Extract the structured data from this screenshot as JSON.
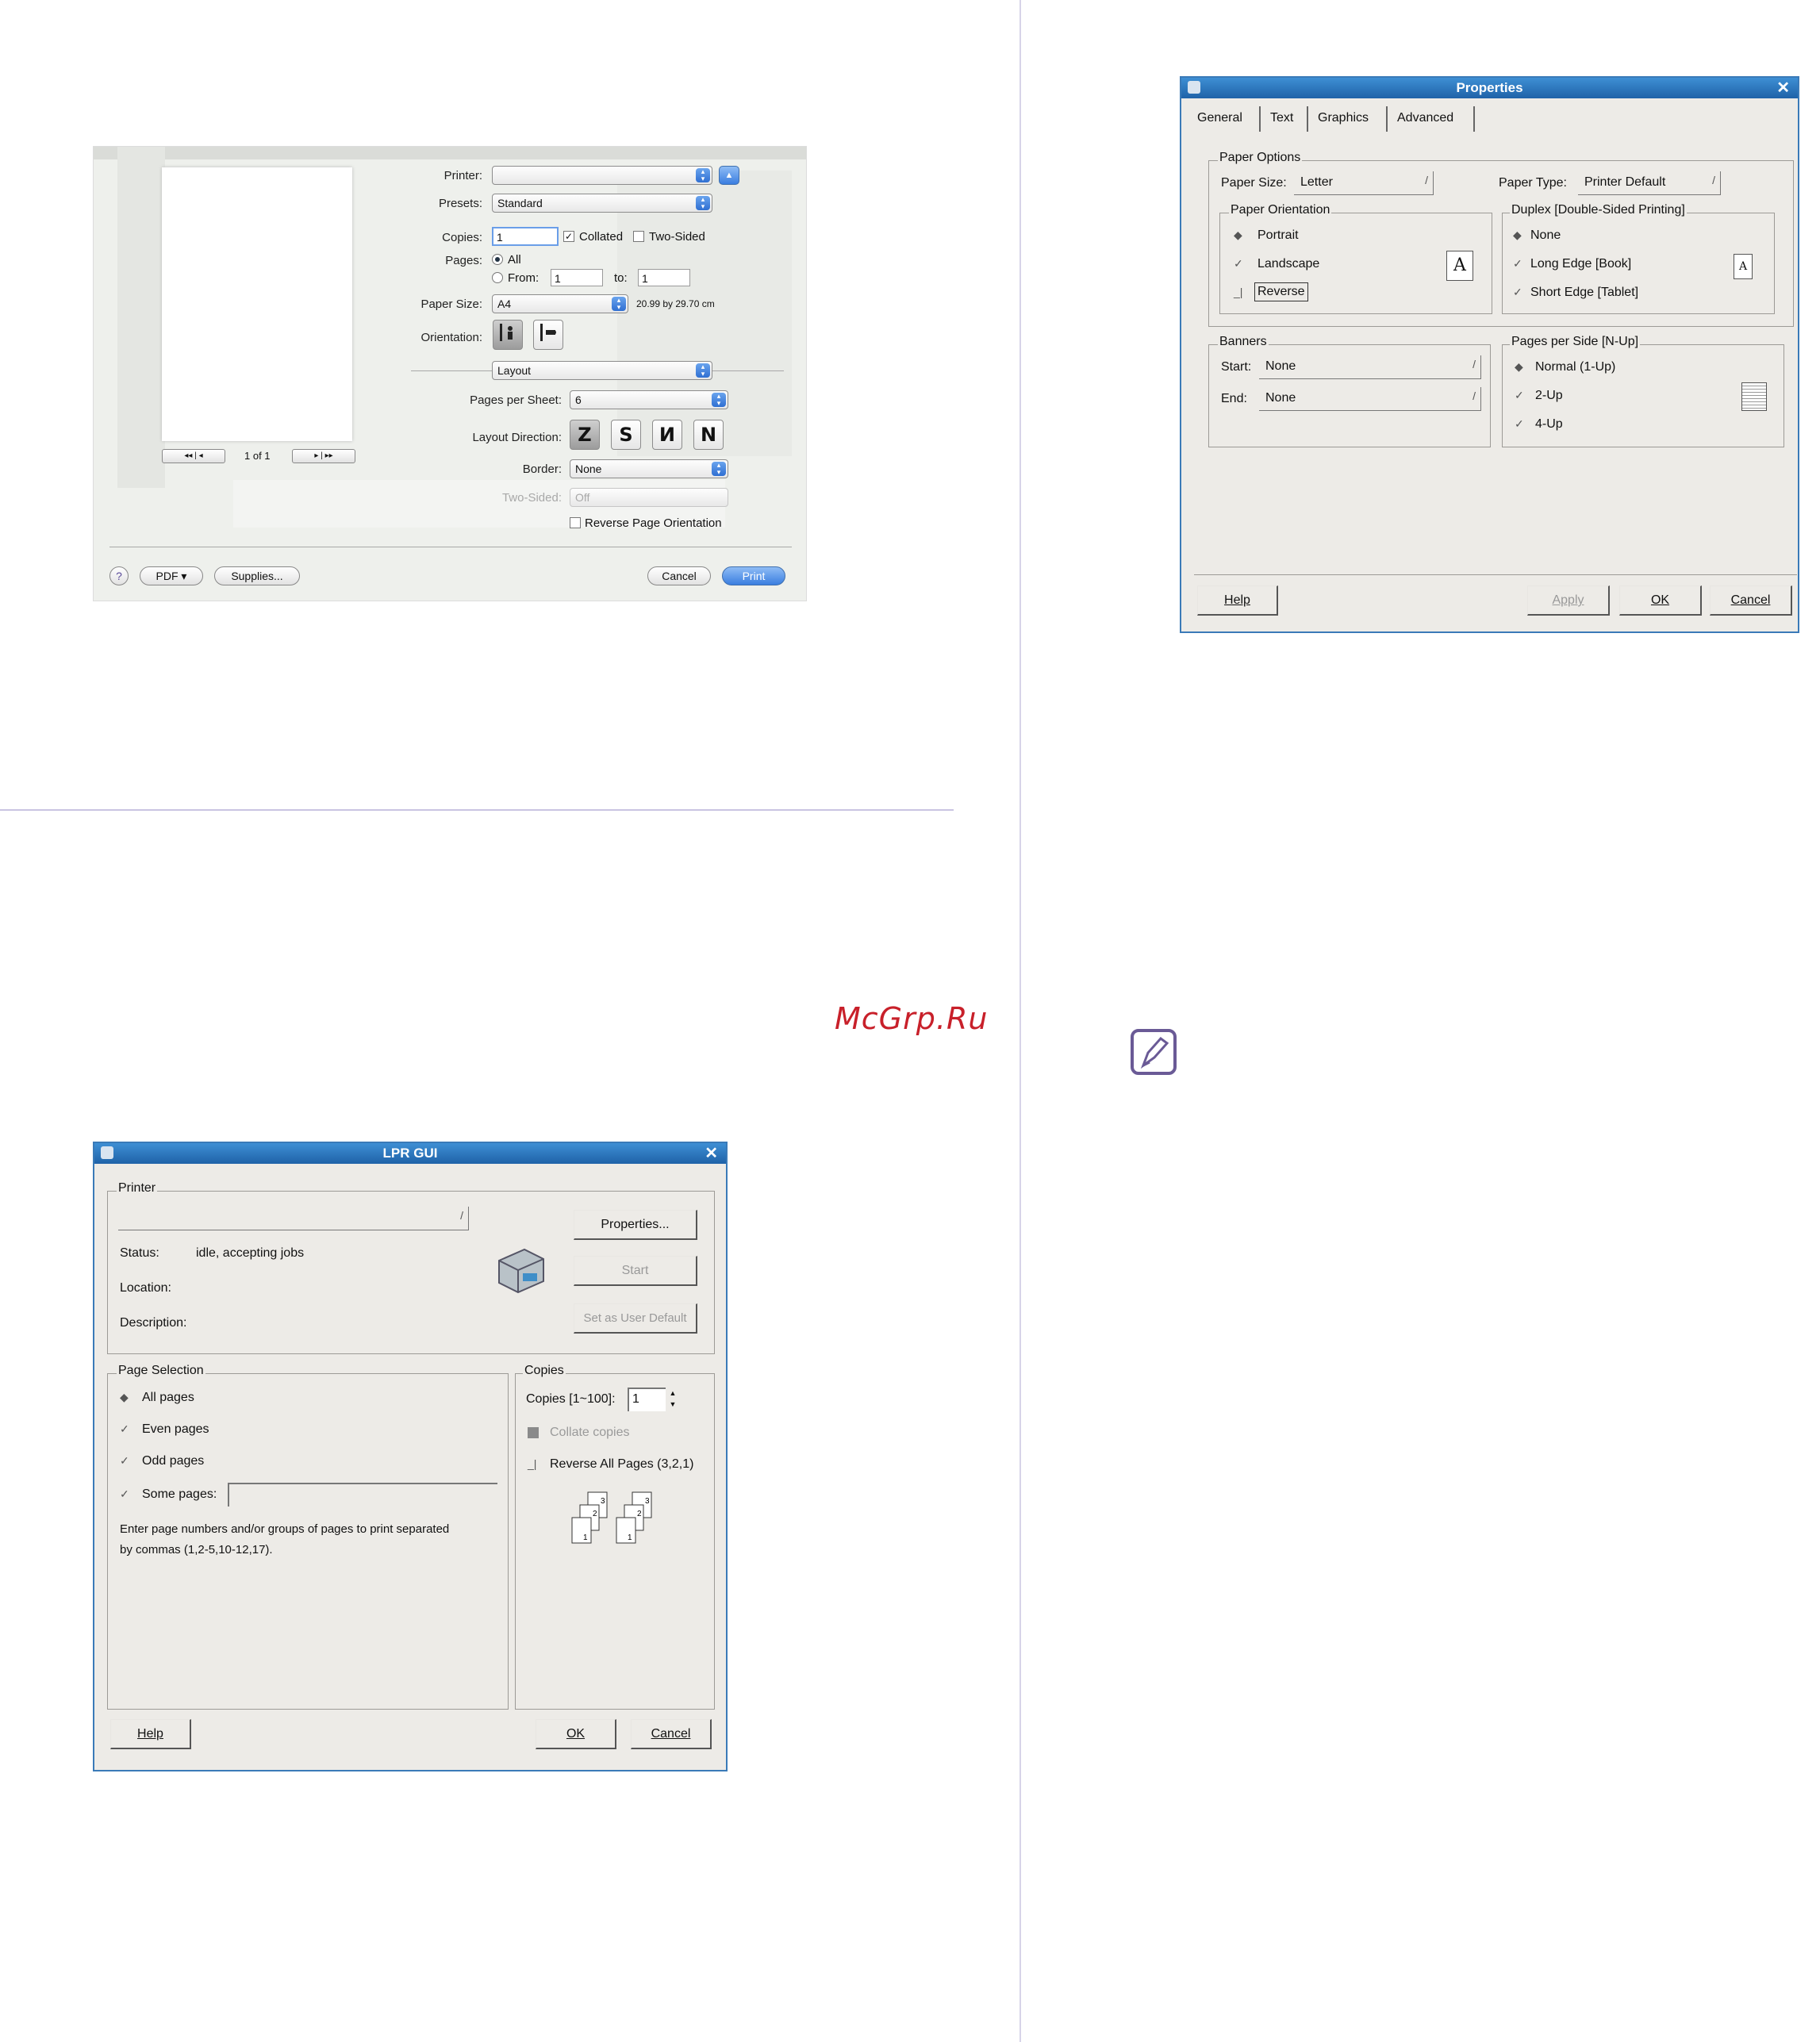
{
  "watermark": "McGrp.Ru",
  "mac_dialog": {
    "printer_label": "Printer:",
    "presets_label": "Presets:",
    "presets_value": "Standard",
    "copies_label": "Copies:",
    "copies_value": "1",
    "collated_label": "Collated",
    "two_sided_label": "Two-Sided",
    "pages_label": "Pages:",
    "pages_all": "All",
    "pages_from": "From:",
    "from_value": "1",
    "to_label": "to:",
    "to_value": "1",
    "paper_size_label": "Paper Size:",
    "paper_size_value": "A4",
    "paper_size_dims": "20.99 by 29.70 cm",
    "orientation_label": "Orientation:",
    "section_value": "Layout",
    "pages_per_sheet_label": "Pages per Sheet:",
    "pages_per_sheet_value": "6",
    "layout_direction_label": "Layout Direction:",
    "layout_direction_icons": [
      "Z",
      "S",
      "N",
      "N"
    ],
    "border_label": "Border:",
    "border_value": "None",
    "two_sided_field_label": "Two-Sided:",
    "two_sided_value": "Off",
    "reverse_orientation_label": "Reverse Page Orientation",
    "page_counter": "1 of 1",
    "help_symbol": "?",
    "pdf_button": "PDF ▾",
    "supplies_button": "Supplies...",
    "cancel_button": "Cancel",
    "print_button": "Print"
  },
  "properties_dialog": {
    "title": "Properties",
    "close": "✕",
    "tabs": [
      "General",
      "Text",
      "Graphics",
      "Advanced"
    ],
    "paper_options_title": "Paper Options",
    "paper_size_label": "Paper Size:",
    "paper_size_value": "Letter",
    "paper_type_label": "Paper Type:",
    "paper_type_value": "Printer Default",
    "orientation_title": "Paper Orientation",
    "portrait": "Portrait",
    "landscape": "Landscape",
    "reverse": "Reverse",
    "duplex_title": "Duplex [Double-Sided Printing]",
    "duplex_none": "None",
    "duplex_long": "Long Edge [Book]",
    "duplex_short": "Short Edge [Tablet]",
    "doc_glyph": "A",
    "banners_title": "Banners",
    "start_label": "Start:",
    "start_value": "None",
    "end_label": "End:",
    "end_value": "None",
    "nup_title": "Pages per Side [N-Up]",
    "nup_1": "Normal (1-Up)",
    "nup_2": "2-Up",
    "nup_4": "4-Up",
    "help_button": "Help",
    "apply_button": "Apply",
    "ok_button": "OK",
    "cancel_button": "Cancel"
  },
  "lpr_dialog": {
    "title": "LPR GUI",
    "close": "✕",
    "printer_title": "Printer",
    "status_label": "Status:",
    "status_value": "idle, accepting jobs",
    "location_label": "Location:",
    "description_label": "Description:",
    "properties_button": "Properties...",
    "start_button": "Start",
    "set_default_button": "Set as User Default",
    "page_selection_title": "Page Selection",
    "all_pages": "All pages",
    "even_pages": "Even pages",
    "odd_pages": "Odd pages",
    "some_pages": "Some pages:",
    "hint_line1": "Enter page numbers and/or groups of pages to print separated",
    "hint_line2": "by commas (1,2-5,10-12,17).",
    "copies_title": "Copies",
    "copies_label": "Copies [1~100]:",
    "copies_value": "1",
    "collate_label": "Collate copies",
    "reverse_label": "Reverse All Pages (3,2,1)",
    "help_button": "Help",
    "ok_button": "OK",
    "cancel_button": "Cancel"
  }
}
